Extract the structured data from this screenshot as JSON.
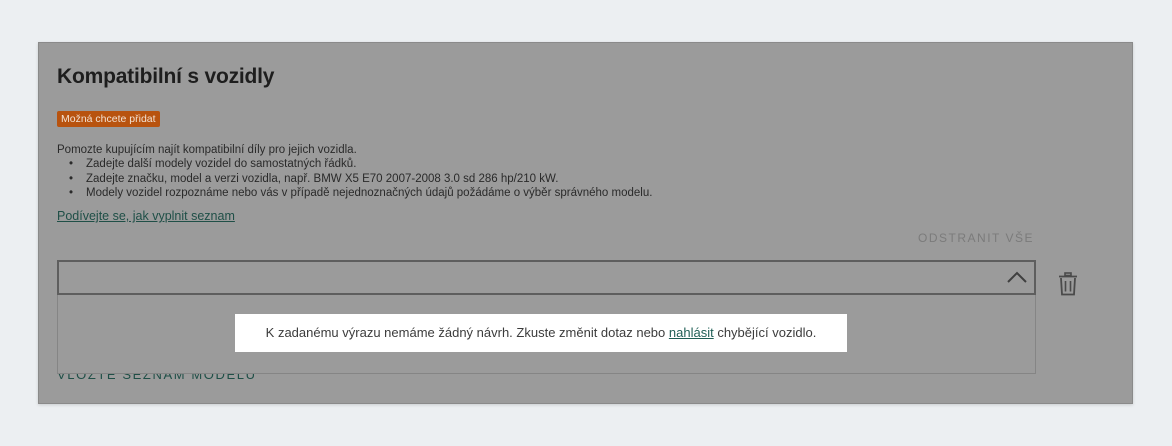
{
  "section": {
    "title": "Kompatibilní s vozidly",
    "badge": "Možná chcete přidat",
    "intro": "Pomozte kupujícím najít kompatibilní díly pro jejich vozidla.",
    "bullets": [
      "Zadejte další modely vozidel do samostatných řádků.",
      "Zadejte značku, model a verzi vozidla, např. BMW X5 E70 2007-2008 3.0 sd 286 hp/210 kW.",
      "Modely vozidel rozpoznáme nebo vás v případě nejednoznačných údajů požádáme o výběr správného modelu."
    ],
    "bullet_char": "•",
    "howto_link": "Podívejte se, jak vyplnit seznam",
    "remove_all": "ODSTRANIT VŠE",
    "list_link": "VLOŽTE SEZNAM MODELŮ"
  },
  "vehicle_input": {
    "value": "",
    "placeholder": ""
  },
  "notice": {
    "before": "K zadanému výrazu nemáme žádný návrh. Zkuste změnit dotaz nebo ",
    "link": "nahlásit",
    "after": " chybějící vozidlo."
  },
  "colors": {
    "overlay": "#9b9b9b",
    "badge": "#b8530f",
    "link": "#1f4f47",
    "page_bg": "#eceff2"
  },
  "icons": {
    "dropdown": "chevron-up-icon",
    "delete": "trash-icon"
  }
}
